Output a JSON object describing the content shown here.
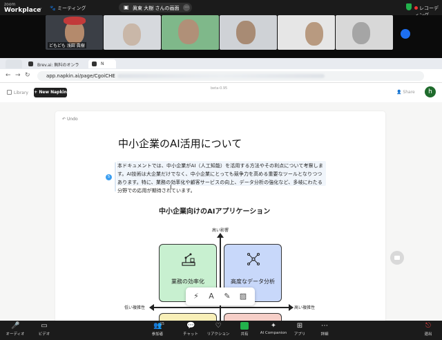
{
  "zoom_top": {
    "logo_small": "zoom",
    "logo_main": "Workplace",
    "meeting_label": "ミーティング",
    "share_banner": "眞東 大樹 さんの画面",
    "recording_label": "レコーディング"
  },
  "gallery": {
    "tile1_name": "どもども 浅田 眞樹"
  },
  "browser": {
    "tabs": [
      {
        "label": "Brev.ai: 無料のオンライン…"
      },
      {
        "label": "N"
      }
    ],
    "url_prefix": "app.napkin.ai/page/CgoiCHE"
  },
  "app_header": {
    "library_label": "Library",
    "new_button": "+ New Napkin",
    "doc_badge": "beta-0.95",
    "share_label": "Share",
    "avatar_letter": "h"
  },
  "document": {
    "undo_label": "Undo",
    "title": "中小企業のAI活用について",
    "paragraph": "本ドキュメントでは、中小企業がAI（人工知能）を活用する方法やその利点について考察します。AI技術は大企業だけでなく、中小企業にとっても競争力を高める重要なツールとなりつつあります。特に、業務の効率化や顧客サービスの向上、データ分析の強化など、多岐にわたる分野での応用が期待されています。",
    "para_dot": "S",
    "diagram": {
      "title": "中小企業向けのAIアプリケーション",
      "axis_top": "高い影響",
      "axis_left": "低い複雑性",
      "axis_right": "高い複雑性",
      "quadrant_tl": "業務の効率化",
      "quadrant_tr": "高度なデータ分析",
      "color_green": "#c8f0d0",
      "color_blue": "#c8d8fa",
      "color_yellow": "#f8efb8",
      "color_red": "#f6cfc8"
    }
  },
  "zoom_bottom": {
    "controls": [
      {
        "label": "オーディオ"
      },
      {
        "label": "ビデオ"
      },
      {
        "label": "参加者",
        "badge": "15"
      },
      {
        "label": "チャット"
      },
      {
        "label": "リアクション"
      },
      {
        "label": "共有"
      },
      {
        "label": "AI Companion"
      },
      {
        "label": "アプリ"
      },
      {
        "label": "詳細"
      },
      {
        "label": "退出"
      }
    ]
  }
}
